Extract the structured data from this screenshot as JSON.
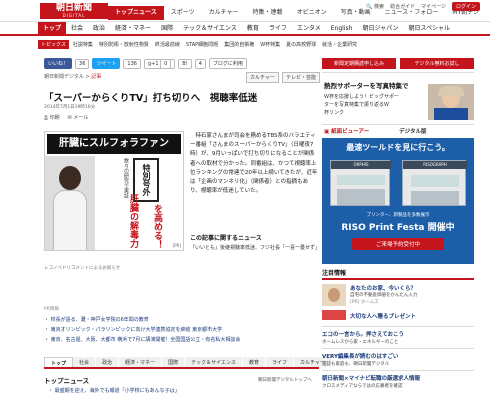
{
  "header": {
    "logo_main": "朝日新聞",
    "logo_sub": "DIGITAL",
    "nav": [
      "トップニュース",
      "スポーツ",
      "カルチャー",
      "特集・連載",
      "オピニオン",
      "写真・動画",
      "ニュース・フォロー",
      "MY朝デジ"
    ],
    "util": [
      "検索",
      "総合ガイド",
      "マイページ",
      "ログイン"
    ]
  },
  "section_nav": [
    "トップ",
    "社会",
    "政治",
    "経済・マネー",
    "国際",
    "テック＆サイエンス",
    "教育",
    "ライフ",
    "エンタメ",
    "English",
    "朝日ジャパン",
    "朝日スペシャル"
  ],
  "topics": {
    "label": "トピックス",
    "items": [
      "社説特集",
      "特別防衛・放射性物質",
      "終活最前線",
      "STAP細胞問題",
      "集団的自衛権",
      "W杯特集",
      "夏の高校野球",
      "就活・企業研究"
    ]
  },
  "social": {
    "facebook": "いいね！",
    "facebook_count": "36",
    "twitter": "ツイート",
    "twitter_count": "136",
    "gplus": "0",
    "hatena": "B!",
    "hatena_count": "4",
    "blog": "ブログに利用"
  },
  "breadcrumb": {
    "home": "朝日新聞デジタル",
    "current": "記事"
  },
  "tags": [
    "カルチャー",
    "テレビ・芸能"
  ],
  "article": {
    "title": "「スーパーからくりTV」打ち切りへ　視聴率低迷",
    "date": "2014年7月1日19時16分",
    "print": "印刷",
    "mail": "メール",
    "body": "　特石家さんまが司会を務めるTBS系のバラエティー番組「さんまのスーパーからくりTV」（日曜夜7時）が、9月いっぱいで打ち切りになることが関係者への取材で分かった。同番組は、かつて視聴率上位ランキングの常連で20年以上続いてきたが、近年は「企画のマンネリ化」（関係者）との指摘もあり、視聴率が低迷していた。",
    "caption": "レコノベドリコメントによるお知らせ",
    "photo_label": "[PR]"
  },
  "photo_ad": {
    "headline": "肝臓にスルフォラファン",
    "special": "特別号外",
    "sub1": "肝臓の解毒力",
    "sub2": "を高める！",
    "small": "数々の研究で実証"
  },
  "related": {
    "title": "この記事に関するニュース",
    "items": [
      "「いいとも」後継視聴率低迷、フジ社長「一喜一憂せず」"
    ]
  },
  "ad_label": "PR情報",
  "ad_links": [
    "・ 校長が語る、灘・神戸女学院の6年間の教育",
    "・ 東京オリンピック・パラリンピックに向け大学連携協定を締結 東京都市大学",
    "・ 東京、名古屋、大阪、大都市 横浜で7月に講演開催！全国国語公立・有名私大相談会"
  ],
  "bottom_tabs": [
    "トップ",
    "社会",
    "政治",
    "経済・マネー",
    "国際",
    "テック＆サイエンス",
    "教育",
    "ライフ",
    "カルチャー"
  ],
  "top_news": {
    "title": "トップニュース",
    "link": "朝日新聞デジタルトップへ",
    "item": "・ 最盛期を迎え、海外でも報道「小学校にもあんな子は」"
  },
  "right": {
    "btn_apply": "新聞定期購読申し込み",
    "btn_digital": "デジタル無料お試し",
    "promo_title": "熱烈サポーターを写真特集で",
    "promo_text1": "W杯を応援しよう！ビッグサポー",
    "promo_text2": "ターを写真特集で振り返るW",
    "promo_text3": "杯リンク",
    "paper_label": "紙面ビューアー",
    "digital_label": "デジタル版",
    "banner_title": "最速ツールドを見に行こう。",
    "banner_sub": "ORPHIS",
    "banner_brand": "RISOGRAPH",
    "banner_event_pre": "プリンター、新製品を多数展示",
    "banner_event": "RISO Print Festa 開催中",
    "banner_cta": "ご来場予約受付中",
    "featured_title": "注目情報",
    "featured": [
      {
        "title": "あなたのお家、今いくら？",
        "sub": "自宅の不動産価値をかんたん入力",
        "meta": "[PR] ホームズ"
      },
      {
        "title": "大切な人へ贈るプレゼント",
        "sub": "",
        "meta": ""
      },
      {
        "title": "エコの一言から。押さえておこう",
        "sub": "ホームレスから家・エネルギーのこと",
        "meta": ""
      },
      {
        "title": "VERY編集長が読むのはすごい",
        "sub": "雑誌も家庭も、朝日新聞デジタル",
        "meta": ""
      },
      {
        "title": "朝日新聞×マイナビ転職の厳選求人情報",
        "sub": "クロスメディアならではの応募者を確認",
        "meta": ""
      }
    ]
  },
  "colors": {
    "brand_red": "#c4151c",
    "link_blue": "#1a3a7a"
  }
}
